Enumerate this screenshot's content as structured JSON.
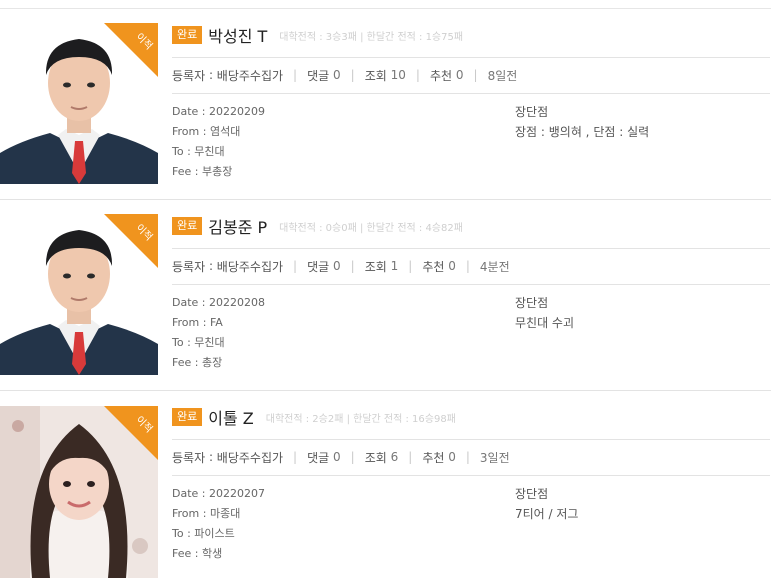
{
  "ribbon_label": "이적",
  "status_label": "완료",
  "labels": {
    "registrant": "등록자",
    "comments": "댓글",
    "views": "조회",
    "recommend": "추천",
    "date": "Date",
    "from": "From",
    "to": "To",
    "fee": "Fee",
    "pros_cons": "장단점"
  },
  "colors": {
    "accent": "#f0941e",
    "divider": "#e3e3e3"
  },
  "posts": [
    {
      "name": "박성진 T",
      "record": "대학전적 : 3승3패 | 한달간 전적 : 1승75패",
      "registrant": "배당주수집가",
      "comments": "0",
      "views": "10",
      "recommend": "0",
      "time_ago": "8일전",
      "date": "20220209",
      "from": "염석대",
      "to": "무친대",
      "fee": "부총장",
      "pros_cons_lines": [
        "장점 : 뱅의혀 , 단점 : 실력"
      ]
    },
    {
      "name": "김봉준 P",
      "record": "대학전적 : 0승0패 | 한달간 전적 : 4승82패",
      "registrant": "배당주수집가",
      "comments": "0",
      "views": "1",
      "recommend": "0",
      "time_ago": "4분전",
      "date": "20220208",
      "from": "FA",
      "to": "무친대",
      "fee": "총장",
      "pros_cons_lines": [
        "무친대 수괴"
      ]
    },
    {
      "name": "이톨 Z",
      "record": "대학전적 : 2승2패 | 한달간 전적 : 16승98패",
      "registrant": "배당주수집가",
      "comments": "0",
      "views": "6",
      "recommend": "0",
      "time_ago": "3일전",
      "date": "20220207",
      "from": "마종대",
      "to": "파이스트",
      "fee": "학생",
      "pros_cons_lines": [
        "7티어 / 저그"
      ]
    }
  ]
}
